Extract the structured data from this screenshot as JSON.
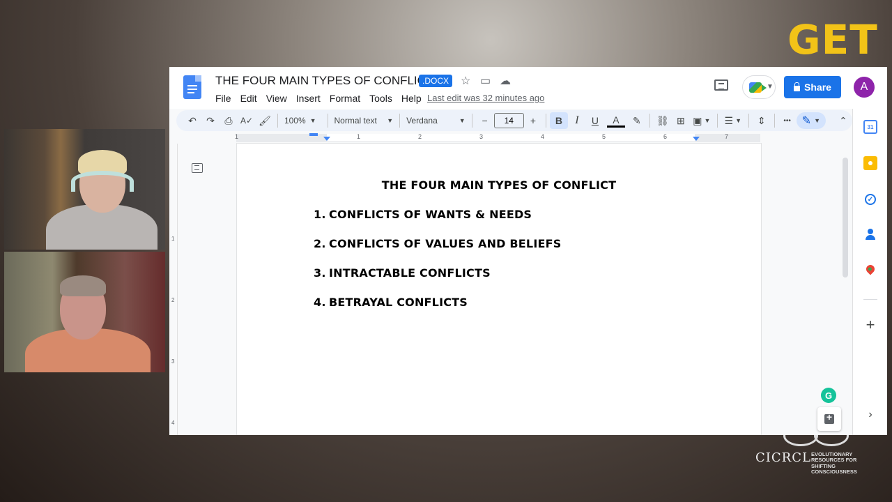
{
  "background": {
    "get_text": "GET",
    "brand_name": "CICRCL",
    "brand_tagline": "EVOLUTIONARY RESOURCES FOR SHIFTING CONSCIOUSNESS"
  },
  "doc": {
    "title": "THE FOUR MAIN TYPES OF CONFLICT",
    "format_badge": ".DOCX",
    "last_edit": "Last edit was 32 minutes ago",
    "menus": [
      "File",
      "Edit",
      "View",
      "Insert",
      "Format",
      "Tools",
      "Help"
    ],
    "share_label": "Share",
    "avatar_initial": "A"
  },
  "toolbar": {
    "zoom": "100%",
    "style": "Normal text",
    "font": "Verdana",
    "font_size": "14",
    "bold": "B",
    "italic": "I",
    "underline": "U",
    "text_color": "A",
    "more": "•••"
  },
  "ruler": {
    "numbers": [
      "1",
      "1",
      "2",
      "3",
      "4",
      "5",
      "6",
      "7"
    ],
    "vertical_numbers": [
      "1",
      "2",
      "3",
      "4"
    ]
  },
  "content": {
    "heading": "THE FOUR MAIN TYPES OF CONFLICT",
    "items": [
      {
        "num": "1.",
        "text": "CONFLICTS OF WANTS & NEEDS"
      },
      {
        "num": "2.",
        "text": "CONFLICTS OF VALUES AND BELIEFS"
      },
      {
        "num": "3.",
        "text": "INTRACTABLE CONFLICTS"
      },
      {
        "num": "4.",
        "text": "BETRAYAL CONFLICTS"
      }
    ]
  },
  "side_panel": {
    "calendar_day": "31",
    "plus": "+",
    "chevron": "›"
  },
  "grammarly_letter": "G",
  "colors": {
    "share_blue": "#1a73e8",
    "avatar_purple": "#8e24aa",
    "get_yellow": "#f2c318"
  }
}
